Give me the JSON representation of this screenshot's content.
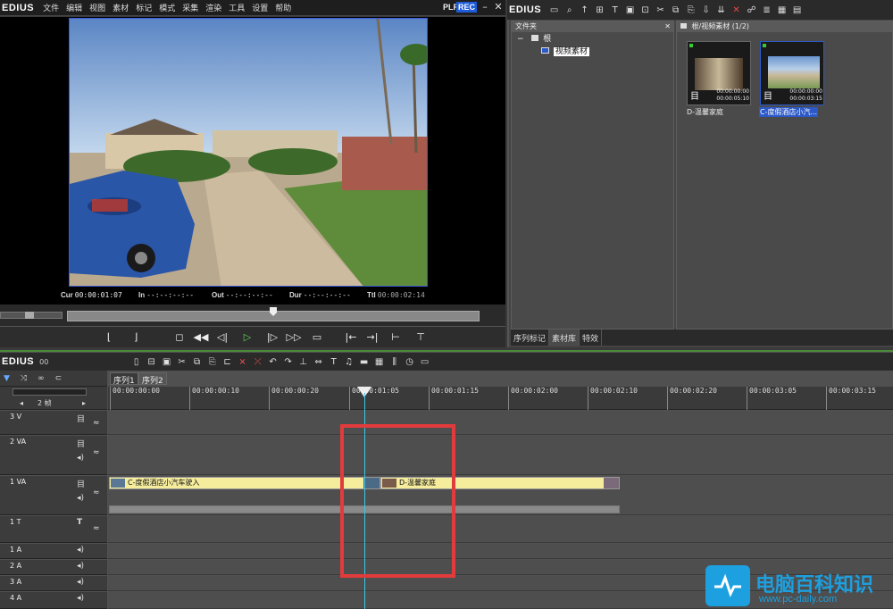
{
  "app": {
    "logo": "EDIUS",
    "menu": [
      "文件",
      "编辑",
      "视图",
      "素材",
      "标记",
      "模式",
      "采集",
      "渲染",
      "工具",
      "设置",
      "帮助"
    ],
    "plr": "PLR",
    "rec": "REC"
  },
  "preview": {
    "cur_label": "Cur",
    "cur": "00:00:01:07",
    "in_label": "In",
    "in": "--:--:--:--",
    "out_label": "Out",
    "out": "--:--:--:--",
    "dur_label": "Dur",
    "dur": "--:--:--:--",
    "ttl_label": "Ttl",
    "ttl": "00:00:02:14"
  },
  "bin": {
    "logo": "EDIUS",
    "folder_header": "文件夹",
    "root": "根",
    "subfolder": "视频素材",
    "clip_header": "根/视频素材 (1/2)",
    "clips": [
      {
        "label": "D-温馨家庭",
        "tc1": "00:00:00:00",
        "tc2": "00:00:05:10"
      },
      {
        "label": "C-度假酒店小汽...",
        "tc1": "00:00:00:00",
        "tc2": "00:00:03:15"
      }
    ],
    "tabs": [
      "序列标记",
      "素材库",
      "特效"
    ]
  },
  "timeline": {
    "logo": "EDIUS",
    "tc_field": "00",
    "seq_tabs": [
      "序列1",
      "序列2"
    ],
    "zoom": "2 帧",
    "ruler": [
      "00:00:00:00",
      "00:00:00:10",
      "00:00:00:20",
      "00:00:01:05",
      "00:00:01:15",
      "00:00:02:00",
      "00:00:02:10",
      "00:00:02:20",
      "00:00:03:05",
      "00:00:03:15"
    ],
    "tracks": [
      "3 V",
      "2 VA",
      "1 VA",
      "1 T",
      "1 A",
      "2 A",
      "3 A",
      "4 A"
    ],
    "clips": [
      "C-度假酒店小汽车驶入",
      "D-温馨家庭"
    ]
  },
  "watermark": {
    "title": "电脑百科知识",
    "url": "www.pc-daily.com"
  }
}
